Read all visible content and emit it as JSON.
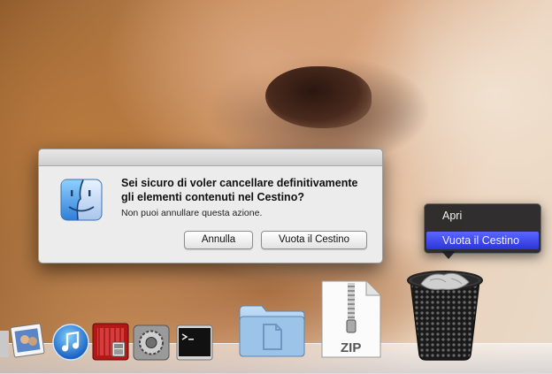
{
  "dialog": {
    "title": "Sei sicuro di voler cancellare definitivamente gli elementi contenuti nel Cestino?",
    "message": "Non puoi annullare questa azione.",
    "cancel_label": "Annulla",
    "confirm_label": "Vuota il Cestino"
  },
  "context_menu": {
    "items": [
      {
        "label": "Apri",
        "selected": false
      },
      {
        "label": "Vuota il Cestino",
        "selected": true
      }
    ]
  },
  "dock": {
    "items": [
      {
        "name": "preview",
        "icon": "photos-icon"
      },
      {
        "name": "itunes",
        "icon": "itunes-icon"
      },
      {
        "name": "photo-booth",
        "icon": "photo-booth-icon"
      },
      {
        "name": "system-preferences",
        "icon": "gear-icon"
      },
      {
        "name": "terminal",
        "icon": "terminal-icon"
      },
      {
        "name": "documents-folder",
        "icon": "folder-icon"
      },
      {
        "name": "zip-archive",
        "icon": "zip-icon",
        "label": "ZIP"
      },
      {
        "name": "trash",
        "icon": "trash-icon"
      }
    ]
  },
  "colors": {
    "menu_highlight": "#3a45e8",
    "dialog_bg": "#ececec"
  }
}
